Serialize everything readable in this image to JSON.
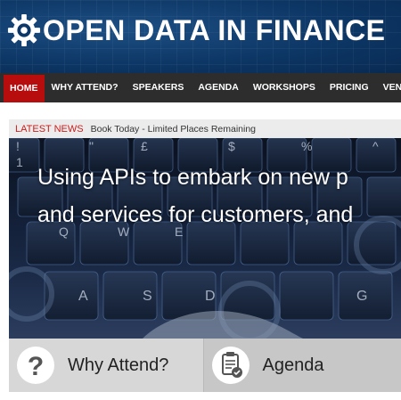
{
  "header": {
    "title": "OPEN DATA IN FINANCE",
    "logo_icon": "gear-icon"
  },
  "nav": {
    "items": [
      {
        "label": "HOME",
        "active": true
      },
      {
        "label": "WHY ATTEND?"
      },
      {
        "label": "SPEAKERS"
      },
      {
        "label": "AGENDA"
      },
      {
        "label": "WORKSHOPS"
      },
      {
        "label": "PRICING"
      },
      {
        "label": "VENUE"
      }
    ]
  },
  "ticker": {
    "label": "LATEST NEWS",
    "text": "Book Today - Limited Places Remaining"
  },
  "hero": {
    "line1": "Using APIs to embark on new p",
    "line2": "and services for customers, and"
  },
  "tiles": [
    {
      "label": "Why Attend?",
      "icon": "question-icon"
    },
    {
      "label": "Agenda",
      "icon": "clipboard-check-icon"
    }
  ],
  "colors": {
    "header_bg": "#0d3766",
    "nav_bg": "#2d2d2d",
    "nav_active": "#b80d0d",
    "ticker_label": "#c8201d"
  }
}
